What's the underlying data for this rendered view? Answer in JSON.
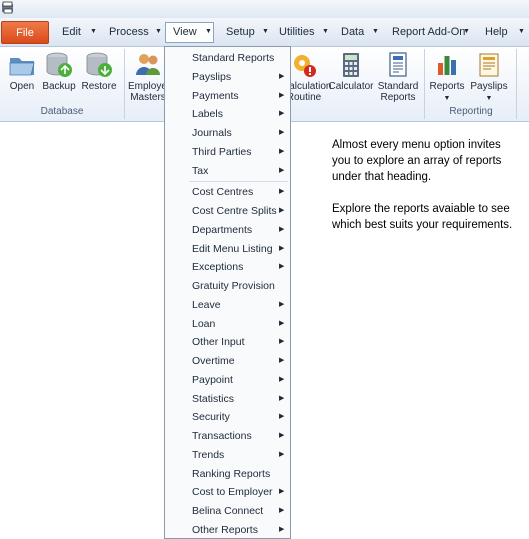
{
  "menubar": {
    "file": "File",
    "items": [
      "Edit",
      "Process",
      "View",
      "Setup",
      "Utilities",
      "Data",
      "Report Add-On",
      "Help"
    ]
  },
  "ribbon": {
    "database": {
      "label": "Database",
      "buttons": [
        "Open",
        "Backup",
        "Restore"
      ]
    },
    "employee": {
      "line1": "Employee",
      "line2": "Masters"
    },
    "calc_routine": {
      "line1": "Calculation",
      "line2": "Routine"
    },
    "calculator": "Calculator",
    "standard_reports": {
      "line1": "Standard",
      "line2": "Reports"
    },
    "reporting": {
      "label": "Reporting",
      "buttons": [
        "Reports",
        "Payslips"
      ]
    }
  },
  "view_menu": {
    "items": [
      {
        "label": "Standard Reports",
        "submenu": false
      },
      {
        "label": "Payslips",
        "submenu": true
      },
      {
        "label": "Payments",
        "submenu": true
      },
      {
        "label": "Labels",
        "submenu": true
      },
      {
        "label": "Journals",
        "submenu": true
      },
      {
        "label": "Third Parties",
        "submenu": true
      },
      {
        "label": "Tax",
        "submenu": true
      },
      {
        "label": "Cost Centres",
        "submenu": true
      },
      {
        "label": "Cost Centre Splits",
        "submenu": true
      },
      {
        "label": "Departments",
        "submenu": true
      },
      {
        "label": "Edit Menu Listing",
        "submenu": true
      },
      {
        "label": "Exceptions",
        "submenu": true
      },
      {
        "label": "Gratuity Provision",
        "submenu": false
      },
      {
        "label": "Leave",
        "submenu": true
      },
      {
        "label": "Loan",
        "submenu": true
      },
      {
        "label": "Other Input",
        "submenu": true
      },
      {
        "label": "Overtime",
        "submenu": true
      },
      {
        "label": "Paypoint",
        "submenu": true
      },
      {
        "label": "Statistics",
        "submenu": true
      },
      {
        "label": "Security",
        "submenu": true
      },
      {
        "label": "Transactions",
        "submenu": true
      },
      {
        "label": "Trends",
        "submenu": true
      },
      {
        "label": "Ranking Reports",
        "submenu": false
      },
      {
        "label": "Cost to Employer",
        "submenu": true
      },
      {
        "label": "Belina Connect",
        "submenu": true
      },
      {
        "label": "Other Reports",
        "submenu": true
      }
    ]
  },
  "info": {
    "p1": "Almost every menu option invites you to explore an array of reports under that heading.",
    "p2": "Explore the reports avaiable to see which best suits your requirements."
  },
  "colors": {
    "file_button": "#e05a28",
    "menubar": "#dbe5f1",
    "accent_red": "#d42a1e"
  }
}
